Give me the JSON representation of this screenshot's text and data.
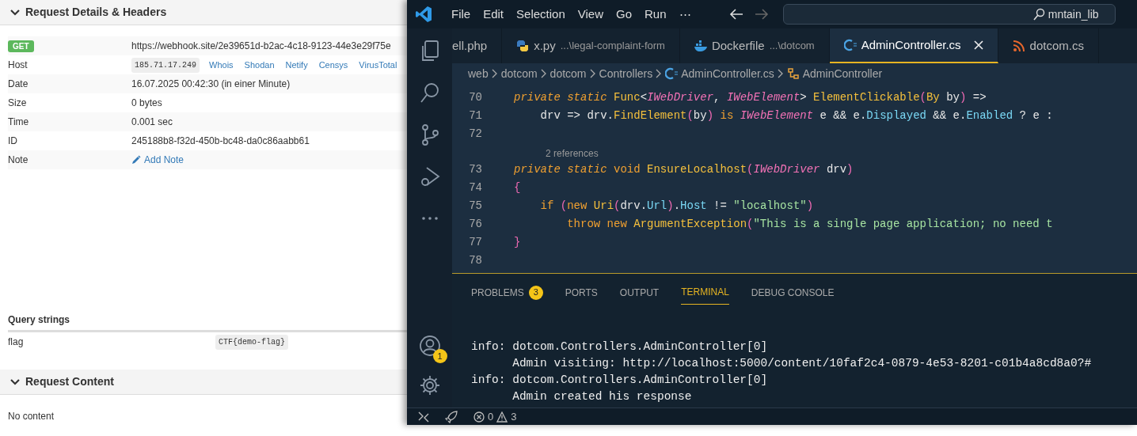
{
  "webhook": {
    "details_header": {
      "title": "Request Details & Headers",
      "expanded": true
    },
    "request": {
      "method": "GET",
      "url": "https://webhook.site/2e39651d-b2ac-4c18-9123-44e3e29f75e"
    },
    "rows": [
      {
        "label": "Host",
        "kind": "host",
        "value": "185.71.17.249",
        "links": [
          "Whois",
          "Shodan",
          "Netify",
          "Censys",
          "VirusTotal"
        ]
      },
      {
        "label": "Date",
        "kind": "text",
        "value": "16.07.2025 00:42:30 (in einer Minute)"
      },
      {
        "label": "Size",
        "kind": "text",
        "value": "0 bytes"
      },
      {
        "label": "Time",
        "kind": "text",
        "value": "0.001 sec"
      },
      {
        "label": "ID",
        "kind": "text",
        "value": "245188b8-f32d-450b-bc48-da0c86aabb61"
      },
      {
        "label": "Note",
        "kind": "note",
        "value": "Add Note"
      }
    ],
    "query": {
      "title": "Query strings",
      "rows": [
        {
          "key": "flag",
          "value": "CTF{demo-flag}"
        }
      ]
    },
    "content_header": {
      "title": "Request Content",
      "expanded": true
    },
    "content": "No content"
  },
  "vscode": {
    "menu": [
      "File",
      "Edit",
      "Selection",
      "View",
      "Go",
      "Run",
      "⋯"
    ],
    "search": "mntain_lib",
    "tabs": [
      {
        "label": "ell.php",
        "kind": "php",
        "selected": false
      },
      {
        "label": "x.py",
        "path": "...\\legal-complaint-form",
        "kind": "python",
        "selected": false
      },
      {
        "label": "Dockerfile",
        "path": "...\\dotcom",
        "kind": "docker",
        "selected": false
      },
      {
        "label": "AdminController.cs",
        "kind": "csharp",
        "selected": true
      },
      {
        "label": "dotcom.cs",
        "kind": "rss",
        "selected": false
      }
    ],
    "breadcrumb": [
      {
        "label": "web"
      },
      {
        "label": "dotcom"
      },
      {
        "label": "dotcom"
      },
      {
        "label": "Controllers"
      },
      {
        "label": "AdminController.cs",
        "kind": "csharp"
      },
      {
        "label": "AdminController",
        "kind": "class"
      }
    ],
    "code": [
      {
        "number": "70",
        "tokens": [
          {
            "kind": "kw",
            "t": "private static "
          },
          {
            "kind": "cls",
            "t": "Func"
          },
          {
            "kind": "plain",
            "t": "<"
          },
          {
            "kind": "type",
            "t": "IWebDriver"
          },
          {
            "kind": "plain",
            "t": ", "
          },
          {
            "kind": "type",
            "t": "IWebElement"
          },
          {
            "kind": "plain",
            "t": "> "
          },
          {
            "kind": "fn",
            "t": "ElementClickable"
          },
          {
            "kind": "paren",
            "t": "("
          },
          {
            "kind": "cls",
            "t": "By"
          },
          {
            "kind": "plain",
            "t": " by"
          },
          {
            "kind": "paren",
            "t": ")"
          },
          {
            "kind": "plain",
            "t": " =>"
          }
        ]
      },
      {
        "number": "71",
        "tokens": [
          {
            "kind": "plain",
            "t": "    drv => drv."
          },
          {
            "kind": "fn",
            "t": "FindElement"
          },
          {
            "kind": "paren",
            "t": "("
          },
          {
            "kind": "plain",
            "t": "by"
          },
          {
            "kind": "paren",
            "t": ")"
          },
          {
            "kind": "ctl",
            "t": " is "
          },
          {
            "kind": "type",
            "t": "IWebElement"
          },
          {
            "kind": "plain",
            "t": " e && e."
          },
          {
            "kind": "prop",
            "t": "Displayed"
          },
          {
            "kind": "plain",
            "t": " && e."
          },
          {
            "kind": "prop",
            "t": "Enabled"
          },
          {
            "kind": "plain",
            "t": " ? e :"
          }
        ]
      },
      {
        "number": "72"
      },
      {
        "lens": "2 references"
      },
      {
        "number": "73",
        "tokens": [
          {
            "kind": "kw",
            "t": "private static "
          },
          {
            "kind": "ctl",
            "t": "void "
          },
          {
            "kind": "fn",
            "t": "EnsureLocalhost"
          },
          {
            "kind": "paren",
            "t": "("
          },
          {
            "kind": "type",
            "t": "IWebDriver"
          },
          {
            "kind": "plain",
            "t": " drv"
          },
          {
            "kind": "paren",
            "t": ")"
          }
        ]
      },
      {
        "number": "74",
        "tokens": [
          {
            "kind": "paren",
            "t": "{"
          }
        ]
      },
      {
        "number": "75",
        "tokens": [
          {
            "kind": "ctl",
            "t": "    if "
          },
          {
            "kind": "paren",
            "t": "("
          },
          {
            "kind": "ctl",
            "t": "new "
          },
          {
            "kind": "cls",
            "t": "Uri"
          },
          {
            "kind": "paren",
            "t": "("
          },
          {
            "kind": "plain",
            "t": "drv."
          },
          {
            "kind": "prop",
            "t": "Url"
          },
          {
            "kind": "paren",
            "t": ")"
          },
          {
            "kind": "plain",
            "t": "."
          },
          {
            "kind": "prop",
            "t": "Host"
          },
          {
            "kind": "plain",
            "t": " != "
          },
          {
            "kind": "str",
            "t": "\"localhost\""
          },
          {
            "kind": "paren",
            "t": ")"
          }
        ]
      },
      {
        "number": "76",
        "tokens": [
          {
            "kind": "ctl",
            "t": "        throw new "
          },
          {
            "kind": "cls",
            "t": "ArgumentException"
          },
          {
            "kind": "paren",
            "t": "("
          },
          {
            "kind": "str",
            "t": "\"This is a single page application; no need t"
          }
        ]
      },
      {
        "number": "77",
        "tokens": [
          {
            "kind": "paren",
            "t": "}"
          }
        ]
      },
      {
        "number": "78"
      }
    ],
    "panel_tabs": [
      {
        "label": "PROBLEMS",
        "badge": "3",
        "selected": false
      },
      {
        "label": "PORTS",
        "selected": false
      },
      {
        "label": "OUTPUT",
        "selected": false
      },
      {
        "label": "TERMINAL",
        "selected": true
      },
      {
        "label": "DEBUG CONSOLE",
        "selected": false
      }
    ],
    "terminal": [
      "info: dotcom.Controllers.AdminController[0]",
      "      Admin visiting: http://localhost:5000/content/10faf2c4-0879-4e53-8201-c01b4a8cd8a0?#",
      "info: dotcom.Controllers.AdminController[0]",
      "      Admin created his response"
    ],
    "account_badge": "1",
    "status": {
      "errors": "0",
      "warnings": "3"
    }
  }
}
